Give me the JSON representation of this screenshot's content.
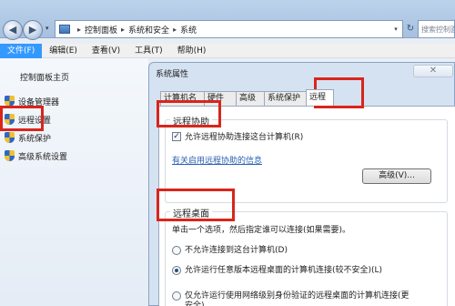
{
  "address_bar": {
    "crumbs": [
      "控制面板",
      "系统和安全",
      "系统"
    ],
    "search_placeholder": "搜索控制面板"
  },
  "menu": [
    {
      "label": "文件(F)",
      "active": true
    },
    {
      "label": "编辑(E)",
      "active": false
    },
    {
      "label": "查看(V)",
      "active": false
    },
    {
      "label": "工具(T)",
      "active": false
    },
    {
      "label": "帮助(H)",
      "active": false
    }
  ],
  "left_nav": {
    "home": "控制面板主页",
    "items": [
      {
        "label": "设备管理器",
        "icon": "shield-icon"
      },
      {
        "label": "远程设置",
        "icon": "shield-icon",
        "highlighted": true
      },
      {
        "label": "系统保护",
        "icon": "shield-icon"
      },
      {
        "label": "高级系统设置",
        "icon": "shield-icon"
      }
    ]
  },
  "dialog": {
    "title": "系统属性",
    "tabs": [
      {
        "label": "计算机名",
        "selected": false
      },
      {
        "label": "硬件",
        "selected": false
      },
      {
        "label": "高级",
        "selected": false
      },
      {
        "label": "系统保护",
        "selected": false
      },
      {
        "label": "远程",
        "selected": true
      }
    ],
    "remote_assistance": {
      "title": "远程协助",
      "checkbox_label": "允许远程协助连接这台计算机(R)",
      "checked": true,
      "link": "有关启用远程协助的信息",
      "advanced_button": "高级(V)..."
    },
    "remote_desktop": {
      "title": "远程桌面",
      "instruction": "单击一个选项，然后指定谁可以连接(如果需要)。",
      "options": [
        {
          "label": "不允许连接到这台计算机(D)",
          "selected": false
        },
        {
          "label": "允许运行任意版本远程桌面的计算机连接(较不安全)(L)",
          "selected": true
        },
        {
          "label": "仅允许运行使用网络级别身份验证的远程桌面的计算机连接(更安全)",
          "selected": false
        }
      ]
    }
  },
  "highlight_color": "#d9251c"
}
